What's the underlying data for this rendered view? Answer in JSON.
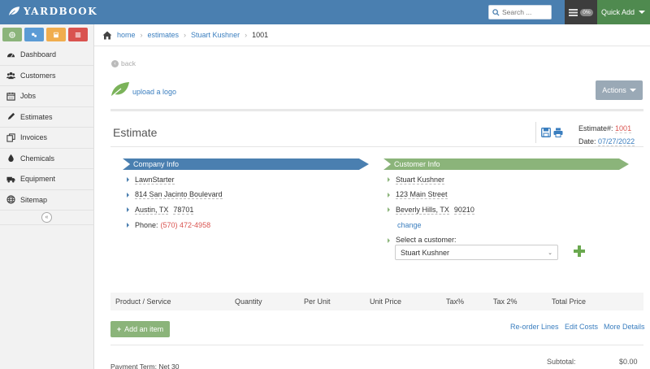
{
  "app": {
    "name": "Yardbook"
  },
  "header": {
    "search_placeholder": "Search ...",
    "progress_badge": "0%",
    "quick_add_label": "Quick Add"
  },
  "sidebar": {
    "button_colors": [
      "#8bb47a",
      "#5b9bd5",
      "#f0ad4e",
      "#d9534f"
    ],
    "items": [
      {
        "label": "Dashboard",
        "icon": "dashboard-icon"
      },
      {
        "label": "Customers",
        "icon": "users-icon"
      },
      {
        "label": "Jobs",
        "icon": "calendar-icon"
      },
      {
        "label": "Estimates",
        "icon": "pencil-icon"
      },
      {
        "label": "Invoices",
        "icon": "copy-icon"
      },
      {
        "label": "Chemicals",
        "icon": "drop-icon"
      },
      {
        "label": "Equipment",
        "icon": "truck-icon"
      },
      {
        "label": "Sitemap",
        "icon": "globe-icon"
      }
    ],
    "collapse_label": "«"
  },
  "breadcrumb": [
    "home",
    "estimates",
    "Stuart Kushner",
    "1001"
  ],
  "page": {
    "back_label": "back",
    "upload_logo_label": "upload a logo",
    "actions_label": "Actions",
    "title": "Estimate",
    "estimate_number_label": "Estimate#:",
    "estimate_number": "1001",
    "date_label": "Date:",
    "date": "07/27/2022"
  },
  "company": {
    "header": "Company Info",
    "name": "LawnStarter",
    "address": "814 San Jacinto Boulevard",
    "city_state": "Austin, TX",
    "zip": "78701",
    "phone_label": "Phone:",
    "phone": "(570) 472-4958"
  },
  "customer": {
    "header": "Customer Info",
    "name": "Stuart Kushner",
    "address": "123 Main Street",
    "city_state": "Beverly Hills, TX",
    "zip": "90210",
    "change_label": "change",
    "select_label": "Select a customer:",
    "selected": "Stuart Kushner"
  },
  "table": {
    "columns": [
      "Product / Service",
      "Quantity",
      "Per Unit",
      "Unit Price",
      "Tax%",
      "Tax 2%",
      "Total Price"
    ],
    "add_item_label": "Add an item",
    "links": [
      "Re-order Lines",
      "Edit Costs",
      "More Details"
    ]
  },
  "footer": {
    "payment_term_label": "Payment Term:",
    "payment_term": "Net 30",
    "subtotal_label": "Subtotal:",
    "subtotal": "$0.00"
  }
}
